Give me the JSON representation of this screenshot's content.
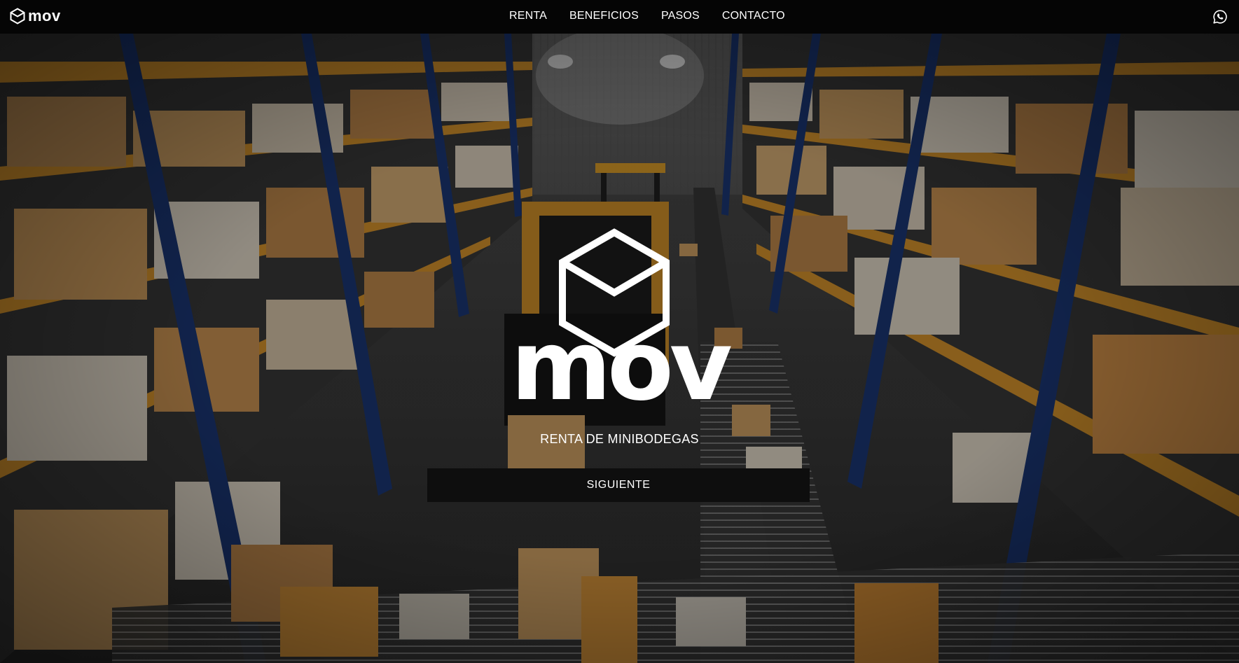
{
  "header": {
    "brand_name": "mov",
    "brand_icon": "cube-icon",
    "nav_items": [
      {
        "label": "RENTA"
      },
      {
        "label": "BENEFICIOS"
      },
      {
        "label": "PASOS"
      },
      {
        "label": "CONTACTO"
      }
    ],
    "contact_icon": "whatsapp-icon"
  },
  "hero": {
    "logo_icon": "cube-icon",
    "title": "mov",
    "tagline": "RENTA DE MINIBODEGAS",
    "cta_label": "SIGUIENTE"
  },
  "colors": {
    "topbar": "#050505",
    "text": "#ffffff",
    "button": "#0e0e0e",
    "shelf_orange": "#e09a2e",
    "shelf_blue": "#1d3a7a"
  }
}
